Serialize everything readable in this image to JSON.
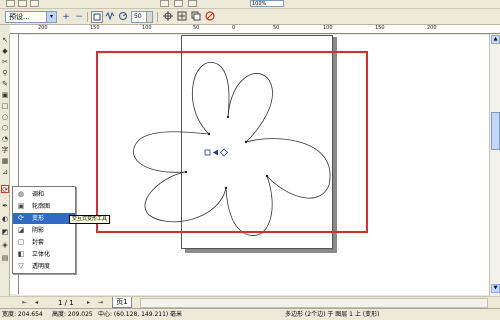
{
  "top_toolbar": {
    "zoom_value": "100%"
  },
  "property_bar": {
    "preset_value": "预设...",
    "preset_arrow": "▾",
    "plus_label": "+",
    "minus_label": "−",
    "stepper_value": "50"
  },
  "ruler": {
    "top_ticks": [
      "200",
      "150",
      "100",
      "50",
      "0",
      "50",
      "100",
      "150",
      "200"
    ]
  },
  "toolbox": {
    "tools": [
      "pointer",
      "shape",
      "zoom",
      "freehand",
      "smart-fill",
      "rectangle",
      "ellipse",
      "polygon",
      "text",
      "table",
      "interactive-blend",
      "eyedropper",
      "outline",
      "fill",
      "interactive-fill"
    ]
  },
  "flyout": {
    "items": [
      {
        "label": "调和",
        "icon": "blend-icon"
      },
      {
        "label": "轮廓图",
        "icon": "contour-icon"
      },
      {
        "label": "变形",
        "icon": "distort-icon"
      },
      {
        "label": "阴影",
        "icon": "shadow-icon"
      },
      {
        "label": "封套",
        "icon": "envelope-icon"
      },
      {
        "label": "立体化",
        "icon": "extrude-icon"
      },
      {
        "label": "透明度",
        "icon": "transparency-icon"
      }
    ],
    "highlighted_index": 2,
    "tooltip": "交互式变形工具"
  },
  "page_bar": {
    "counter": "1 / 1",
    "tab": "页1"
  },
  "status_bar": {
    "width": "宽度: 204.654",
    "height": "高度: 209.025",
    "center": "中心: (60.128, 149.211)",
    "unit": "毫米",
    "object_info": "多边形 (2个边) 于 图层 1 上 (变形)"
  },
  "colors": {
    "accent_red": "#cf3131",
    "highlight_blue": "#316ac5",
    "chrome": "#ece9d8"
  }
}
